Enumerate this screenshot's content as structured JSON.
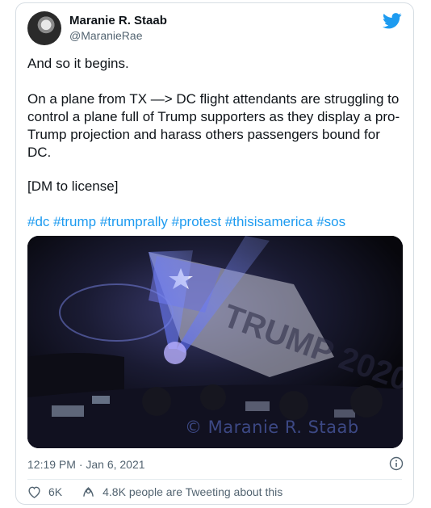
{
  "author": {
    "name": "Maranie R. Staab",
    "handle": "@MaranieRae"
  },
  "tweet": {
    "line1": "And so it begins.",
    "line2": "On a plane from TX —> DC flight attendants are struggling to control a plane full of Trump supporters as they display a pro-Trump projection and harass others passengers bound for DC.",
    "line3": "[DM to license]",
    "hashtags": [
      "#dc",
      "#trump",
      "#trumprally",
      "#protest",
      "#thisisamerica",
      "#sos"
    ]
  },
  "media": {
    "banner_text": "TRUMP 2020",
    "watermark": "© Maranie R. Staab"
  },
  "meta": {
    "timestamp": "12:19 PM · Jan 6, 2021"
  },
  "actions": {
    "likes": "6K",
    "retweet_text": "4.8K people are Tweeting about this"
  },
  "icons": {
    "brand": "twitter-bird-icon",
    "info": "info-icon",
    "like": "heart-icon",
    "people": "people-talking-icon"
  },
  "colors": {
    "link": "#1d9bf0",
    "muted": "#536471",
    "text": "#0f1419"
  }
}
